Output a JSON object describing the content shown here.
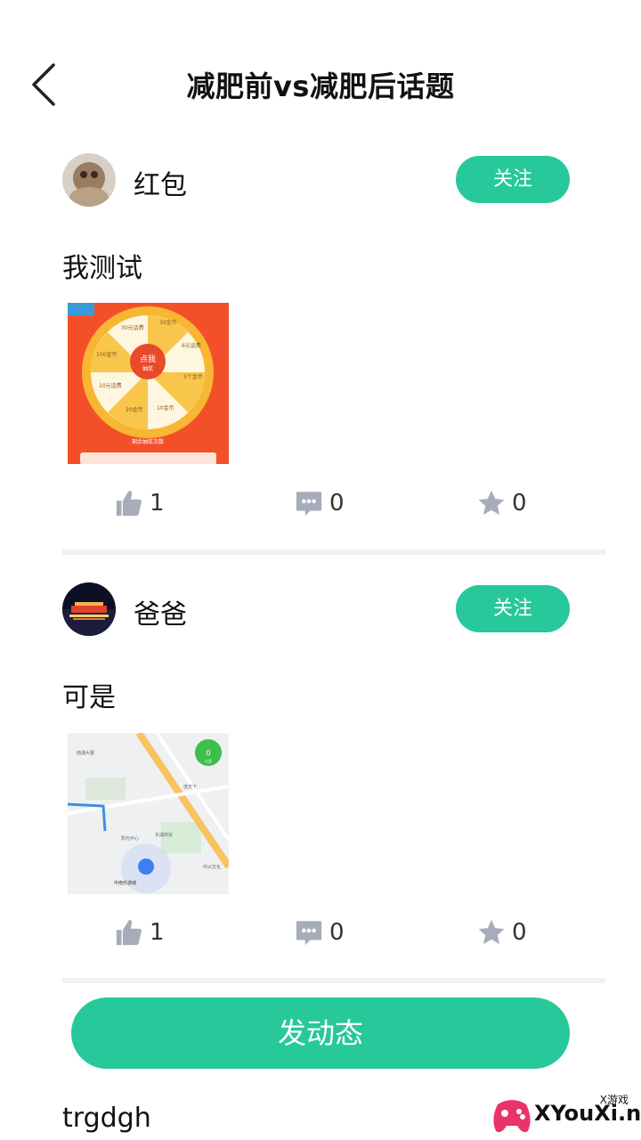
{
  "header": {
    "title": "减肥前vs减肥后话题"
  },
  "posts": [
    {
      "username": "红包",
      "follow_label": "关注",
      "text": "我测试",
      "likes": "1",
      "comments": "0",
      "favorites": "0",
      "image": {
        "wheel_labels": [
          "30元话费",
          "30金币",
          "6元话费",
          "5个金币",
          "10金币",
          "20金币",
          "10元话费",
          "100金币"
        ],
        "center_label": "点我",
        "center_sub": "抽奖",
        "caption": "剩余抽奖次数"
      }
    },
    {
      "username": "爸爸",
      "follow_label": "关注",
      "text": "可是",
      "likes": "1",
      "comments": "0",
      "favorites": "0",
      "image": {
        "places": [
          "南湖大厦",
          "中南乐游城",
          "佳天下",
          "中兴文化",
          "阳光中心",
          "东湖商贸"
        ],
        "badge_value": "0",
        "badge_unit": "公里"
      }
    }
  ],
  "post_button": {
    "label": "发动态"
  },
  "trailing_text": "trgdgh",
  "watermark": {
    "text": "XYouXi.net",
    "tag": "X游戏"
  },
  "colors": {
    "accent": "#27c89a",
    "icon_gray": "#a6acba"
  }
}
